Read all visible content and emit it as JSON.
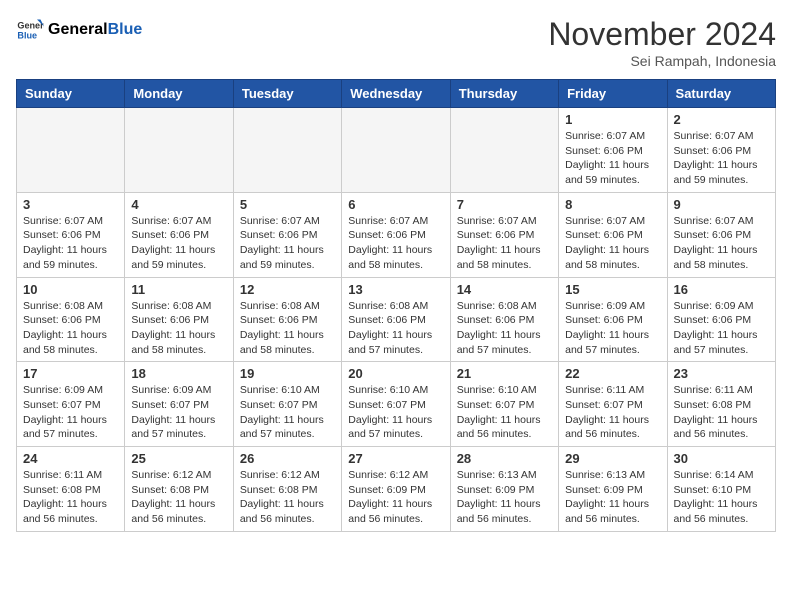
{
  "header": {
    "logo": {
      "general": "General",
      "blue": "Blue"
    },
    "month": "November 2024",
    "location": "Sei Rampah, Indonesia"
  },
  "weekdays": [
    "Sunday",
    "Monday",
    "Tuesday",
    "Wednesday",
    "Thursday",
    "Friday",
    "Saturday"
  ],
  "weeks": [
    [
      {
        "day": "",
        "info": ""
      },
      {
        "day": "",
        "info": ""
      },
      {
        "day": "",
        "info": ""
      },
      {
        "day": "",
        "info": ""
      },
      {
        "day": "",
        "info": ""
      },
      {
        "day": "1",
        "info": "Sunrise: 6:07 AM\nSunset: 6:06 PM\nDaylight: 11 hours\nand 59 minutes."
      },
      {
        "day": "2",
        "info": "Sunrise: 6:07 AM\nSunset: 6:06 PM\nDaylight: 11 hours\nand 59 minutes."
      }
    ],
    [
      {
        "day": "3",
        "info": "Sunrise: 6:07 AM\nSunset: 6:06 PM\nDaylight: 11 hours\nand 59 minutes."
      },
      {
        "day": "4",
        "info": "Sunrise: 6:07 AM\nSunset: 6:06 PM\nDaylight: 11 hours\nand 59 minutes."
      },
      {
        "day": "5",
        "info": "Sunrise: 6:07 AM\nSunset: 6:06 PM\nDaylight: 11 hours\nand 59 minutes."
      },
      {
        "day": "6",
        "info": "Sunrise: 6:07 AM\nSunset: 6:06 PM\nDaylight: 11 hours\nand 58 minutes."
      },
      {
        "day": "7",
        "info": "Sunrise: 6:07 AM\nSunset: 6:06 PM\nDaylight: 11 hours\nand 58 minutes."
      },
      {
        "day": "8",
        "info": "Sunrise: 6:07 AM\nSunset: 6:06 PM\nDaylight: 11 hours\nand 58 minutes."
      },
      {
        "day": "9",
        "info": "Sunrise: 6:07 AM\nSunset: 6:06 PM\nDaylight: 11 hours\nand 58 minutes."
      }
    ],
    [
      {
        "day": "10",
        "info": "Sunrise: 6:08 AM\nSunset: 6:06 PM\nDaylight: 11 hours\nand 58 minutes."
      },
      {
        "day": "11",
        "info": "Sunrise: 6:08 AM\nSunset: 6:06 PM\nDaylight: 11 hours\nand 58 minutes."
      },
      {
        "day": "12",
        "info": "Sunrise: 6:08 AM\nSunset: 6:06 PM\nDaylight: 11 hours\nand 58 minutes."
      },
      {
        "day": "13",
        "info": "Sunrise: 6:08 AM\nSunset: 6:06 PM\nDaylight: 11 hours\nand 57 minutes."
      },
      {
        "day": "14",
        "info": "Sunrise: 6:08 AM\nSunset: 6:06 PM\nDaylight: 11 hours\nand 57 minutes."
      },
      {
        "day": "15",
        "info": "Sunrise: 6:09 AM\nSunset: 6:06 PM\nDaylight: 11 hours\nand 57 minutes."
      },
      {
        "day": "16",
        "info": "Sunrise: 6:09 AM\nSunset: 6:06 PM\nDaylight: 11 hours\nand 57 minutes."
      }
    ],
    [
      {
        "day": "17",
        "info": "Sunrise: 6:09 AM\nSunset: 6:07 PM\nDaylight: 11 hours\nand 57 minutes."
      },
      {
        "day": "18",
        "info": "Sunrise: 6:09 AM\nSunset: 6:07 PM\nDaylight: 11 hours\nand 57 minutes."
      },
      {
        "day": "19",
        "info": "Sunrise: 6:10 AM\nSunset: 6:07 PM\nDaylight: 11 hours\nand 57 minutes."
      },
      {
        "day": "20",
        "info": "Sunrise: 6:10 AM\nSunset: 6:07 PM\nDaylight: 11 hours\nand 57 minutes."
      },
      {
        "day": "21",
        "info": "Sunrise: 6:10 AM\nSunset: 6:07 PM\nDaylight: 11 hours\nand 56 minutes."
      },
      {
        "day": "22",
        "info": "Sunrise: 6:11 AM\nSunset: 6:07 PM\nDaylight: 11 hours\nand 56 minutes."
      },
      {
        "day": "23",
        "info": "Sunrise: 6:11 AM\nSunset: 6:08 PM\nDaylight: 11 hours\nand 56 minutes."
      }
    ],
    [
      {
        "day": "24",
        "info": "Sunrise: 6:11 AM\nSunset: 6:08 PM\nDaylight: 11 hours\nand 56 minutes."
      },
      {
        "day": "25",
        "info": "Sunrise: 6:12 AM\nSunset: 6:08 PM\nDaylight: 11 hours\nand 56 minutes."
      },
      {
        "day": "26",
        "info": "Sunrise: 6:12 AM\nSunset: 6:08 PM\nDaylight: 11 hours\nand 56 minutes."
      },
      {
        "day": "27",
        "info": "Sunrise: 6:12 AM\nSunset: 6:09 PM\nDaylight: 11 hours\nand 56 minutes."
      },
      {
        "day": "28",
        "info": "Sunrise: 6:13 AM\nSunset: 6:09 PM\nDaylight: 11 hours\nand 56 minutes."
      },
      {
        "day": "29",
        "info": "Sunrise: 6:13 AM\nSunset: 6:09 PM\nDaylight: 11 hours\nand 56 minutes."
      },
      {
        "day": "30",
        "info": "Sunrise: 6:14 AM\nSunset: 6:10 PM\nDaylight: 11 hours\nand 56 minutes."
      }
    ]
  ]
}
